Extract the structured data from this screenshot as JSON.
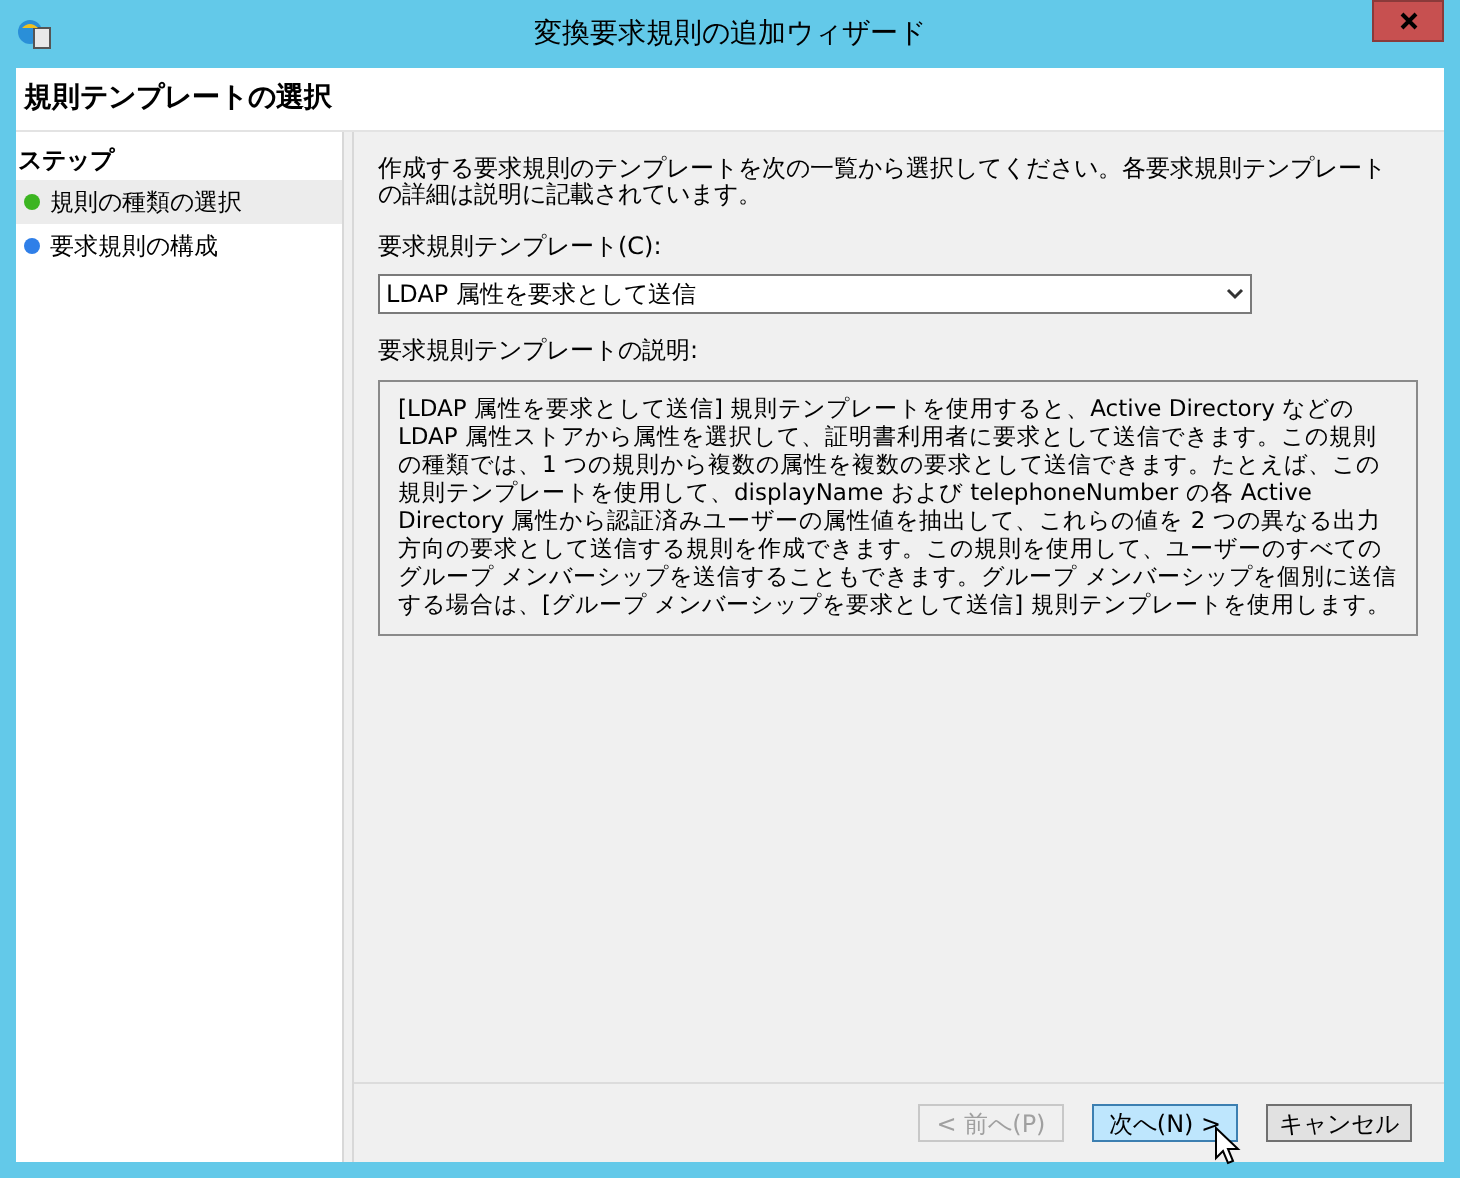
{
  "window": {
    "title": "変換要求規則の追加ウィザード"
  },
  "header": {
    "title": "規則テンプレートの選択"
  },
  "steps": {
    "heading": "ステップ",
    "items": [
      {
        "label": "規則の種類の選択",
        "selected": true,
        "color": "#3cb521"
      },
      {
        "label": "要求規則の構成",
        "selected": false,
        "color": "#2f7fe8"
      }
    ]
  },
  "content": {
    "intro": "作成する要求規則のテンプレートを次の一覧から選択してください。各要求規則テンプレートの詳細は説明に記載されています。",
    "template_label": "要求規則テンプレート(C):",
    "template_value": "LDAP 属性を要求として送信",
    "description_label": "要求規則テンプレートの説明:",
    "description": "[LDAP 属性を要求として送信] 規則テンプレートを使用すると、Active Directory などの LDAP 属性ストアから属性を選択して、証明書利用者に要求として送信できます。この規則の種類では、1 つの規則から複数の属性を複数の要求として送信できます。たとえば、この規則テンプレートを使用して、displayName および telephoneNumber の各 Active Directory 属性から認証済みユーザーの属性値を抽出して、これらの値を 2 つの異なる出力方向の要求として送信する規則を作成できます。この規則を使用して、ユーザーのすべてのグループ メンバーシップを送信することもできます。グループ メンバーシップを個別に送信する場合は、[グループ メンバーシップを要求として送信] 規則テンプレートを使用します。"
  },
  "buttons": [
    {
      "label": "< 前へ(P)",
      "disabled": true,
      "hovered": false
    },
    {
      "label": "次へ(N) >",
      "disabled": false,
      "hovered": true
    },
    {
      "label": "キャンセル",
      "disabled": false,
      "hovered": false
    }
  ]
}
